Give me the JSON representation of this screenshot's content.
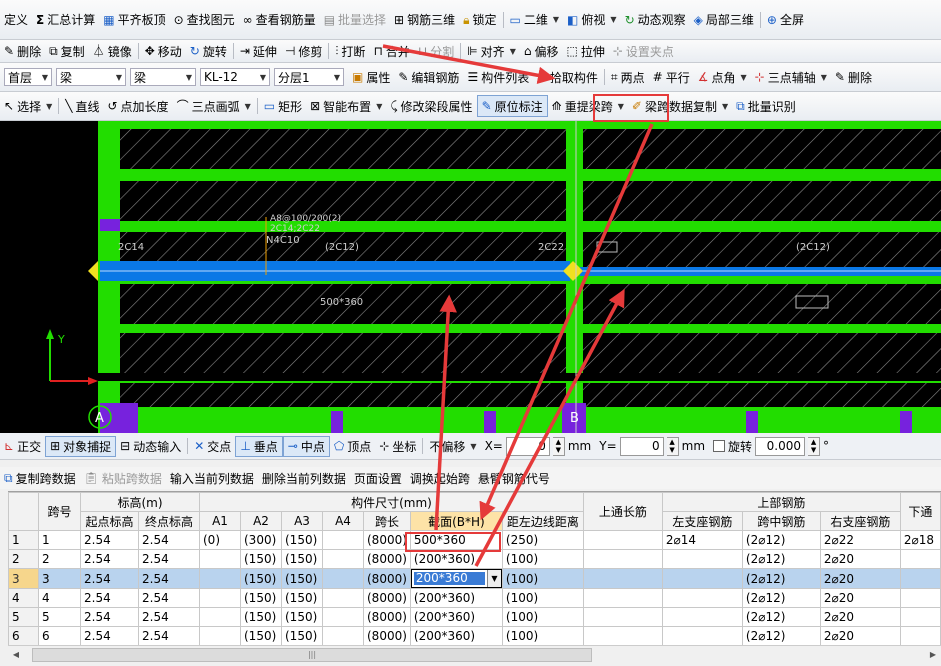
{
  "toolbar1": {
    "define": "定义",
    "sum_calc": "汇总计算",
    "level_slab": "平齐板顶",
    "find_element": "查找图元",
    "view_rebar": "查看钢筋量",
    "batch_select": "批量选择",
    "rebar_3d": "钢筋三维",
    "lock": "锁定",
    "view_2d": "二维",
    "top_view": "俯视",
    "dynamic_view": "动态观察",
    "local_3d": "局部三维",
    "full_screen": "全屏"
  },
  "toolbar2": {
    "delete": "删除",
    "copy": "复制",
    "mirror": "镜像",
    "move": "移动",
    "rotate": "旋转",
    "extend": "延伸",
    "trim": "修剪",
    "break": "打断",
    "merge": "合并",
    "split": "分割",
    "align": "对齐",
    "offset": "偏移",
    "stretch": "拉伸",
    "set_grip": "设置夹点"
  },
  "toolbar3": {
    "floor": "首层",
    "category": "梁",
    "type": "梁",
    "member": "KL-12",
    "layer": "分层1",
    "properties": "属性",
    "edit_rebar": "编辑钢筋",
    "member_list": "构件列表",
    "pick_member": "拾取构件",
    "two_points": "两点",
    "parallel": "平行",
    "point_angle": "点角",
    "three_point_axis": "三点辅轴",
    "delete_short": "删除"
  },
  "toolbar4": {
    "select": "选择",
    "line": "直线",
    "point_length": "点加长度",
    "three_point_arc": "三点画弧",
    "rectangle": "矩形",
    "smart_layout": "智能布置",
    "modify_span_prop": "修改梁段属性",
    "in_situ_label": "原位标注",
    "re_span": "重提梁跨",
    "copy_span_data": "梁跨数据复制",
    "batch_identify": "批量识别"
  },
  "canvas": {
    "axis_a": "A",
    "axis_b": "B",
    "axis_y": "Y",
    "label_2c14": "2C14",
    "label_2c12_left": "(2C12)",
    "label_2c22": "2C22",
    "label_2c12_right": "(2C12)",
    "label_n4c10": "N4C10",
    "label_section": "500*360",
    "label_stirrup": "A8@100/200(2)",
    "label_top_rebar": "2C14;2C22"
  },
  "status": {
    "orthogonal": "正交",
    "object_snap": "对象捕捉",
    "dynamic_input": "动态输入",
    "intersection": "交点",
    "perpendicular": "垂点",
    "midpoint": "中点",
    "vertex": "顶点",
    "coordinate": "坐标",
    "no_offset": "不偏移",
    "x_label": "X=",
    "x_value": "0",
    "y_label": "Y=",
    "y_value": "0",
    "unit_mm": "mm",
    "unit_mm2": "mm",
    "rotate": "旋转",
    "rotate_value": "0.000",
    "degree": "°"
  },
  "grid_toolbar": {
    "copy_span": "复制跨数据",
    "paste_span": "粘贴跨数据",
    "input_col": "输入当前列数据",
    "delete_col": "删除当前列数据",
    "page_setup": "页面设置",
    "swap_start": "调换起始跨",
    "cantilever_code": "悬臂钢筋代号"
  },
  "table": {
    "h_span_no": "跨号",
    "h_elevation": "标高(m)",
    "h_start_elev": "起点标高",
    "h_end_elev": "终点标高",
    "h_dims": "构件尺寸(mm)",
    "h_a1": "A1",
    "h_a2": "A2",
    "h_a3": "A3",
    "h_a4": "A4",
    "h_span_len": "跨长",
    "h_section": "截面(B*H)",
    "h_left_edge": "距左边线距离",
    "h_top_long": "上通长筋",
    "h_top_rebar": "上部钢筋",
    "h_left_support": "左支座钢筋",
    "h_mid_span": "跨中钢筋",
    "h_right_support": "右支座钢筋",
    "h_bottom": "下通",
    "rows": [
      {
        "idx": "1",
        "span": "1",
        "start": "2.54",
        "end": "2.54",
        "a1": "(0)",
        "a2": "(300)",
        "a3": "(150)",
        "a4": "",
        "len": "(8000)",
        "section": "500*360",
        "left": "(250)",
        "toplong": "",
        "lsup": "2⌀14",
        "mid": "(2⌀12)",
        "rsup": "2⌀22",
        "bottom": "2⌀18"
      },
      {
        "idx": "2",
        "span": "2",
        "start": "2.54",
        "end": "2.54",
        "a1": "",
        "a2": "(150)",
        "a3": "(150)",
        "a4": "",
        "len": "(8000)",
        "section": "(200*360)",
        "left": "(100)",
        "toplong": "",
        "lsup": "",
        "mid": "(2⌀12)",
        "rsup": "2⌀20",
        "bottom": ""
      },
      {
        "idx": "3",
        "span": "3",
        "start": "2.54",
        "end": "2.54",
        "a1": "",
        "a2": "(150)",
        "a3": "(150)",
        "a4": "",
        "len": "(8000)",
        "section": "200*360",
        "left": "(100)",
        "toplong": "",
        "lsup": "",
        "mid": "(2⌀12)",
        "rsup": "2⌀20",
        "bottom": ""
      },
      {
        "idx": "4",
        "span": "4",
        "start": "2.54",
        "end": "2.54",
        "a1": "",
        "a2": "(150)",
        "a3": "(150)",
        "a4": "",
        "len": "(8000)",
        "section": "(200*360)",
        "left": "(100)",
        "toplong": "",
        "lsup": "",
        "mid": "(2⌀12)",
        "rsup": "2⌀20",
        "bottom": ""
      },
      {
        "idx": "5",
        "span": "5",
        "start": "2.54",
        "end": "2.54",
        "a1": "",
        "a2": "(150)",
        "a3": "(150)",
        "a4": "",
        "len": "(8000)",
        "section": "(200*360)",
        "left": "(100)",
        "toplong": "",
        "lsup": "",
        "mid": "(2⌀12)",
        "rsup": "2⌀20",
        "bottom": ""
      },
      {
        "idx": "6",
        "span": "6",
        "start": "2.54",
        "end": "2.54",
        "a1": "",
        "a2": "(150)",
        "a3": "(150)",
        "a4": "",
        "len": "(8000)",
        "section": "(200*360)",
        "left": "(100)",
        "toplong": "",
        "lsup": "",
        "mid": "(2⌀12)",
        "rsup": "2⌀20",
        "bottom": ""
      }
    ]
  },
  "colors": {
    "slab_green": "#22dd00",
    "beam_blue": "#0a78e6",
    "column_purple": "#7722dd",
    "annotation_red": "#e53a3a",
    "selection_blue": "#b9d3ee"
  }
}
